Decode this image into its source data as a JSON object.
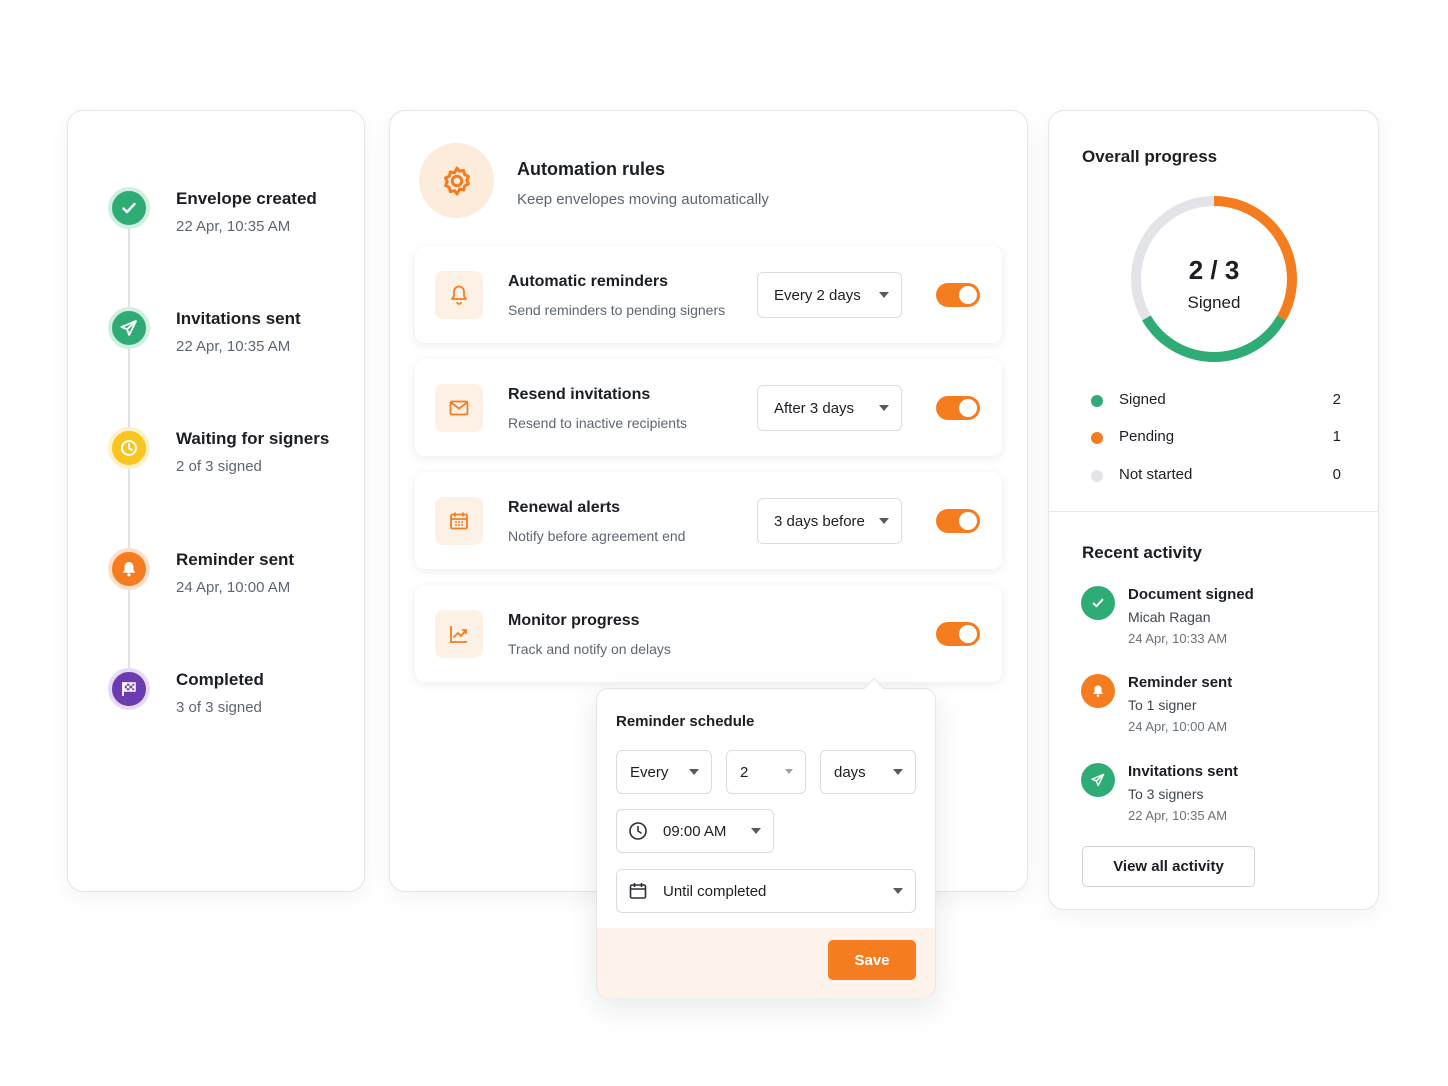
{
  "colors": {
    "green": "#2fac76",
    "orange": "#f57c1f",
    "yellow": "#f8c61f",
    "purple": "#6b3bb0",
    "grey": "#e2e4e7"
  },
  "timeline": [
    {
      "title": "Envelope created",
      "sub": "22 Apr, 10:35 AM",
      "icon": "check-icon",
      "color": "#2fac76"
    },
    {
      "title": "Invitations sent",
      "sub": "22 Apr, 10:35 AM",
      "icon": "send-icon",
      "color": "#2fac76"
    },
    {
      "title": "Waiting for signers",
      "sub": "2 of 3 signed",
      "icon": "clock-icon",
      "color": "#f8c61f"
    },
    {
      "title": "Reminder sent",
      "sub": "24 Apr, 10:00 AM",
      "icon": "bell-icon",
      "color": "#f57c1f"
    },
    {
      "title": "Completed",
      "sub": "3 of 3 signed",
      "icon": "flag-icon",
      "color": "#6b3bb0"
    }
  ],
  "automation": {
    "title": "Automation rules",
    "subtitle": "Keep envelopes moving automatically",
    "rules": [
      {
        "title": "Automatic reminders",
        "sub": "Send reminders to pending signers",
        "select": "Every 2 days",
        "enabled": true,
        "icon": "bell-icon"
      },
      {
        "title": "Resend invitations",
        "sub": "Resend to inactive recipients",
        "select": "After 3 days",
        "enabled": true,
        "icon": "mail-icon"
      },
      {
        "title": "Renewal alerts",
        "sub": "Notify before agreement end",
        "select": "3 days before",
        "enabled": true,
        "icon": "calendar-icon"
      },
      {
        "title": "Monitor progress",
        "sub": "Track and notify on delays",
        "select": "",
        "enabled": true,
        "icon": "chart-icon"
      }
    ]
  },
  "schedule": {
    "title": "Reminder schedule",
    "frequency": "Every",
    "interval": "2",
    "unit": "days",
    "time": "09:00 AM",
    "until": "Until completed",
    "save": "Save"
  },
  "progress": {
    "title": "Overall progress",
    "value": "2 / 3",
    "label": "Signed",
    "legend": [
      {
        "label": "Signed",
        "count": "2",
        "color": "#2fac76"
      },
      {
        "label": "Pending",
        "count": "1",
        "color": "#f57c1f"
      },
      {
        "label": "Not started",
        "count": "0",
        "color": "#e2e4e7"
      }
    ]
  },
  "activity": {
    "title": "Recent activity",
    "items": [
      {
        "title": "Document signed",
        "who": "Micah Ragan",
        "time": "24 Apr, 10:33 AM",
        "icon": "check-icon",
        "color": "#2fac76"
      },
      {
        "title": "Reminder sent",
        "who": "To 1 signer",
        "time": "24 Apr, 10:00 AM",
        "icon": "bell-icon",
        "color": "#f57c1f"
      },
      {
        "title": "Invitations sent",
        "who": "To 3 signers",
        "time": "22 Apr, 10:35 AM",
        "icon": "send-icon",
        "color": "#2fac76"
      }
    ],
    "view_all": "View all activity"
  }
}
